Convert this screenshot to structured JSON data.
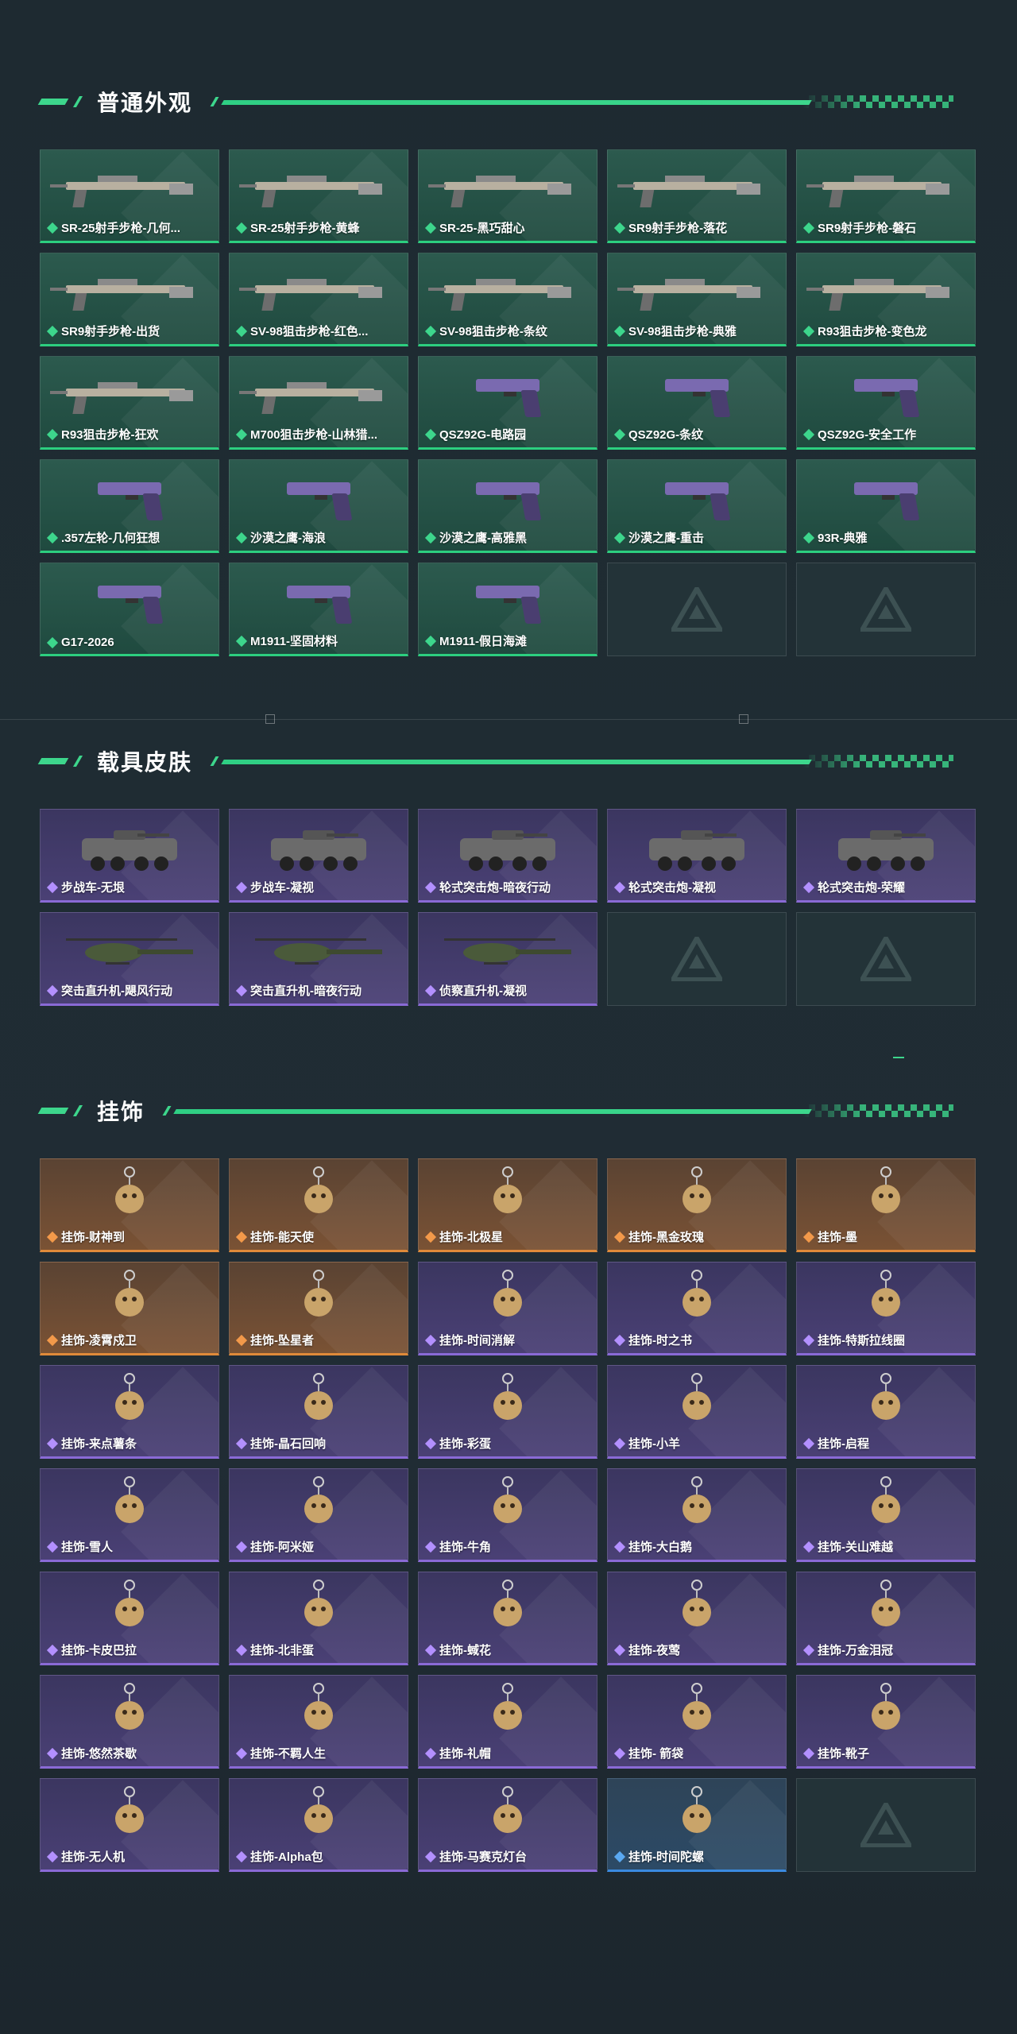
{
  "colors": {
    "accent_green": "#3dd68c",
    "rarity_green": "#3dd68c",
    "rarity_purple": "#b390ff",
    "rarity_orange": "#f2994a",
    "rarity_blue": "#5aa8f0"
  },
  "sections": [
    {
      "title": "普通外观",
      "rows": 5,
      "items": [
        {
          "name": "SR-25射手步枪-几何...",
          "rarity": "green",
          "icon": "rifle-icon"
        },
        {
          "name": "SR-25射手步枪-黄蜂",
          "rarity": "green",
          "icon": "rifle-icon"
        },
        {
          "name": "SR-25-黑巧甜心",
          "rarity": "green",
          "icon": "rifle-icon"
        },
        {
          "name": "SR9射手步枪-落花",
          "rarity": "green",
          "icon": "rifle-icon"
        },
        {
          "name": "SR9射手步枪-磐石",
          "rarity": "green",
          "icon": "rifle-icon"
        },
        {
          "name": "SR9射手步枪-出货",
          "rarity": "green",
          "icon": "rifle-icon"
        },
        {
          "name": "SV-98狙击步枪-红色...",
          "rarity": "green",
          "icon": "sniper-icon"
        },
        {
          "name": "SV-98狙击步枪-条纹",
          "rarity": "green",
          "icon": "sniper-icon"
        },
        {
          "name": "SV-98狙击步枪-典雅",
          "rarity": "green",
          "icon": "sniper-icon"
        },
        {
          "name": "R93狙击步枪-变色龙",
          "rarity": "green",
          "icon": "sniper-icon"
        },
        {
          "name": "R93狙击步枪-狂欢",
          "rarity": "green",
          "icon": "sniper-icon"
        },
        {
          "name": "M700狙击步枪-山林猎...",
          "rarity": "green",
          "icon": "sniper-icon"
        },
        {
          "name": "QSZ92G-电路园",
          "rarity": "green",
          "icon": "pistol-icon"
        },
        {
          "name": "QSZ92G-条纹",
          "rarity": "green",
          "icon": "pistol-icon"
        },
        {
          "name": "QSZ92G-安全工作",
          "rarity": "green",
          "icon": "pistol-icon"
        },
        {
          "name": ".357左轮-几何狂想",
          "rarity": "green",
          "icon": "revolver-icon"
        },
        {
          "name": "沙漠之鹰-海浪",
          "rarity": "green",
          "icon": "pistol-icon"
        },
        {
          "name": "沙漠之鹰-高雅黑",
          "rarity": "green",
          "icon": "pistol-icon"
        },
        {
          "name": "沙漠之鹰-重击",
          "rarity": "green",
          "icon": "pistol-icon"
        },
        {
          "name": "93R-典雅",
          "rarity": "green",
          "icon": "pistol-icon"
        },
        {
          "name": "G17-2026",
          "rarity": "green",
          "icon": "pistol-icon"
        },
        {
          "name": "M1911-坚固材料",
          "rarity": "green",
          "icon": "pistol-icon"
        },
        {
          "name": "M1911-假日海滩",
          "rarity": "green",
          "icon": "pistol-icon"
        },
        {
          "name": "",
          "rarity": "empty",
          "icon": "placeholder-logo-icon"
        },
        {
          "name": "",
          "rarity": "empty",
          "icon": "placeholder-logo-icon"
        }
      ]
    },
    {
      "title": "载具皮肤",
      "rows": 2,
      "items": [
        {
          "name": "步战车-无垠",
          "rarity": "purple",
          "icon": "armored-vehicle-icon"
        },
        {
          "name": "步战车-凝视",
          "rarity": "purple",
          "icon": "armored-vehicle-icon"
        },
        {
          "name": "轮式突击炮-暗夜行动",
          "rarity": "purple",
          "icon": "armored-vehicle-icon"
        },
        {
          "name": "轮式突击炮-凝视",
          "rarity": "purple",
          "icon": "armored-vehicle-icon"
        },
        {
          "name": "轮式突击炮-荣耀",
          "rarity": "purple",
          "icon": "armored-vehicle-icon"
        },
        {
          "name": "突击直升机-飓风行动",
          "rarity": "purple",
          "icon": "helicopter-icon"
        },
        {
          "name": "突击直升机-暗夜行动",
          "rarity": "purple",
          "icon": "helicopter-icon"
        },
        {
          "name": "侦察直升机-凝视",
          "rarity": "purple",
          "icon": "helicopter-icon"
        },
        {
          "name": "",
          "rarity": "empty",
          "icon": "placeholder-logo-icon"
        },
        {
          "name": "",
          "rarity": "empty",
          "icon": "placeholder-logo-icon"
        }
      ]
    },
    {
      "title": "挂饰",
      "rows": 7,
      "items": [
        {
          "name": "挂饰-财神到",
          "rarity": "orange",
          "icon": "charm-icon"
        },
        {
          "name": "挂饰-能天使",
          "rarity": "orange",
          "icon": "charm-icon"
        },
        {
          "name": "挂饰-北极星",
          "rarity": "orange",
          "icon": "charm-icon"
        },
        {
          "name": "挂饰-黑金玫瑰",
          "rarity": "orange",
          "icon": "charm-icon"
        },
        {
          "name": "挂饰-墨",
          "rarity": "orange",
          "icon": "charm-icon"
        },
        {
          "name": "挂饰-凌霄戍卫",
          "rarity": "orange",
          "icon": "charm-icon"
        },
        {
          "name": "挂饰-坠星者",
          "rarity": "orange",
          "icon": "charm-icon"
        },
        {
          "name": "挂饰-时间消解",
          "rarity": "purple",
          "icon": "charm-icon"
        },
        {
          "name": "挂饰-时之书",
          "rarity": "purple",
          "icon": "charm-icon"
        },
        {
          "name": "挂饰-特斯拉线圈",
          "rarity": "purple",
          "icon": "charm-icon"
        },
        {
          "name": "挂饰-来点薯条",
          "rarity": "purple",
          "icon": "charm-icon"
        },
        {
          "name": "挂饰-晶石回响",
          "rarity": "purple",
          "icon": "charm-icon"
        },
        {
          "name": "挂饰-彩蛋",
          "rarity": "purple",
          "icon": "charm-icon"
        },
        {
          "name": "挂饰-小羊",
          "rarity": "purple",
          "icon": "charm-icon"
        },
        {
          "name": "挂饰-启程",
          "rarity": "purple",
          "icon": "charm-icon"
        },
        {
          "name": "挂饰-雪人",
          "rarity": "purple",
          "icon": "charm-icon"
        },
        {
          "name": "挂饰-阿米娅",
          "rarity": "purple",
          "icon": "charm-icon"
        },
        {
          "name": "挂饰-牛角",
          "rarity": "purple",
          "icon": "charm-icon"
        },
        {
          "name": "挂饰-大白鹅",
          "rarity": "purple",
          "icon": "charm-icon"
        },
        {
          "name": "挂饰-关山难越",
          "rarity": "purple",
          "icon": "charm-icon"
        },
        {
          "name": "挂饰-卡皮巴拉",
          "rarity": "purple",
          "icon": "charm-icon"
        },
        {
          "name": "挂饰-北非蛋",
          "rarity": "purple",
          "icon": "charm-icon"
        },
        {
          "name": "挂饰-蜮花",
          "rarity": "purple",
          "icon": "charm-icon"
        },
        {
          "name": "挂饰-夜莺",
          "rarity": "purple",
          "icon": "charm-icon"
        },
        {
          "name": "挂饰-万金泪冠",
          "rarity": "purple",
          "icon": "charm-icon"
        },
        {
          "name": "挂饰-悠然茶歇",
          "rarity": "purple",
          "icon": "charm-icon"
        },
        {
          "name": "挂饰-不羁人生",
          "rarity": "purple",
          "icon": "charm-icon"
        },
        {
          "name": "挂饰-礼帽",
          "rarity": "purple",
          "icon": "charm-icon"
        },
        {
          "name": "挂饰- 箭袋",
          "rarity": "purple",
          "icon": "charm-icon"
        },
        {
          "name": "挂饰-靴子",
          "rarity": "purple",
          "icon": "charm-icon"
        },
        {
          "name": "挂饰-无人机",
          "rarity": "purple",
          "icon": "charm-icon"
        },
        {
          "name": "挂饰-Alpha包",
          "rarity": "purple",
          "icon": "charm-icon"
        },
        {
          "name": "挂饰-马赛克灯台",
          "rarity": "purple",
          "icon": "charm-icon"
        },
        {
          "name": "挂饰-时间陀螺",
          "rarity": "blue",
          "icon": "charm-icon"
        },
        {
          "name": "",
          "rarity": "empty",
          "icon": "placeholder-logo-icon"
        }
      ]
    }
  ]
}
